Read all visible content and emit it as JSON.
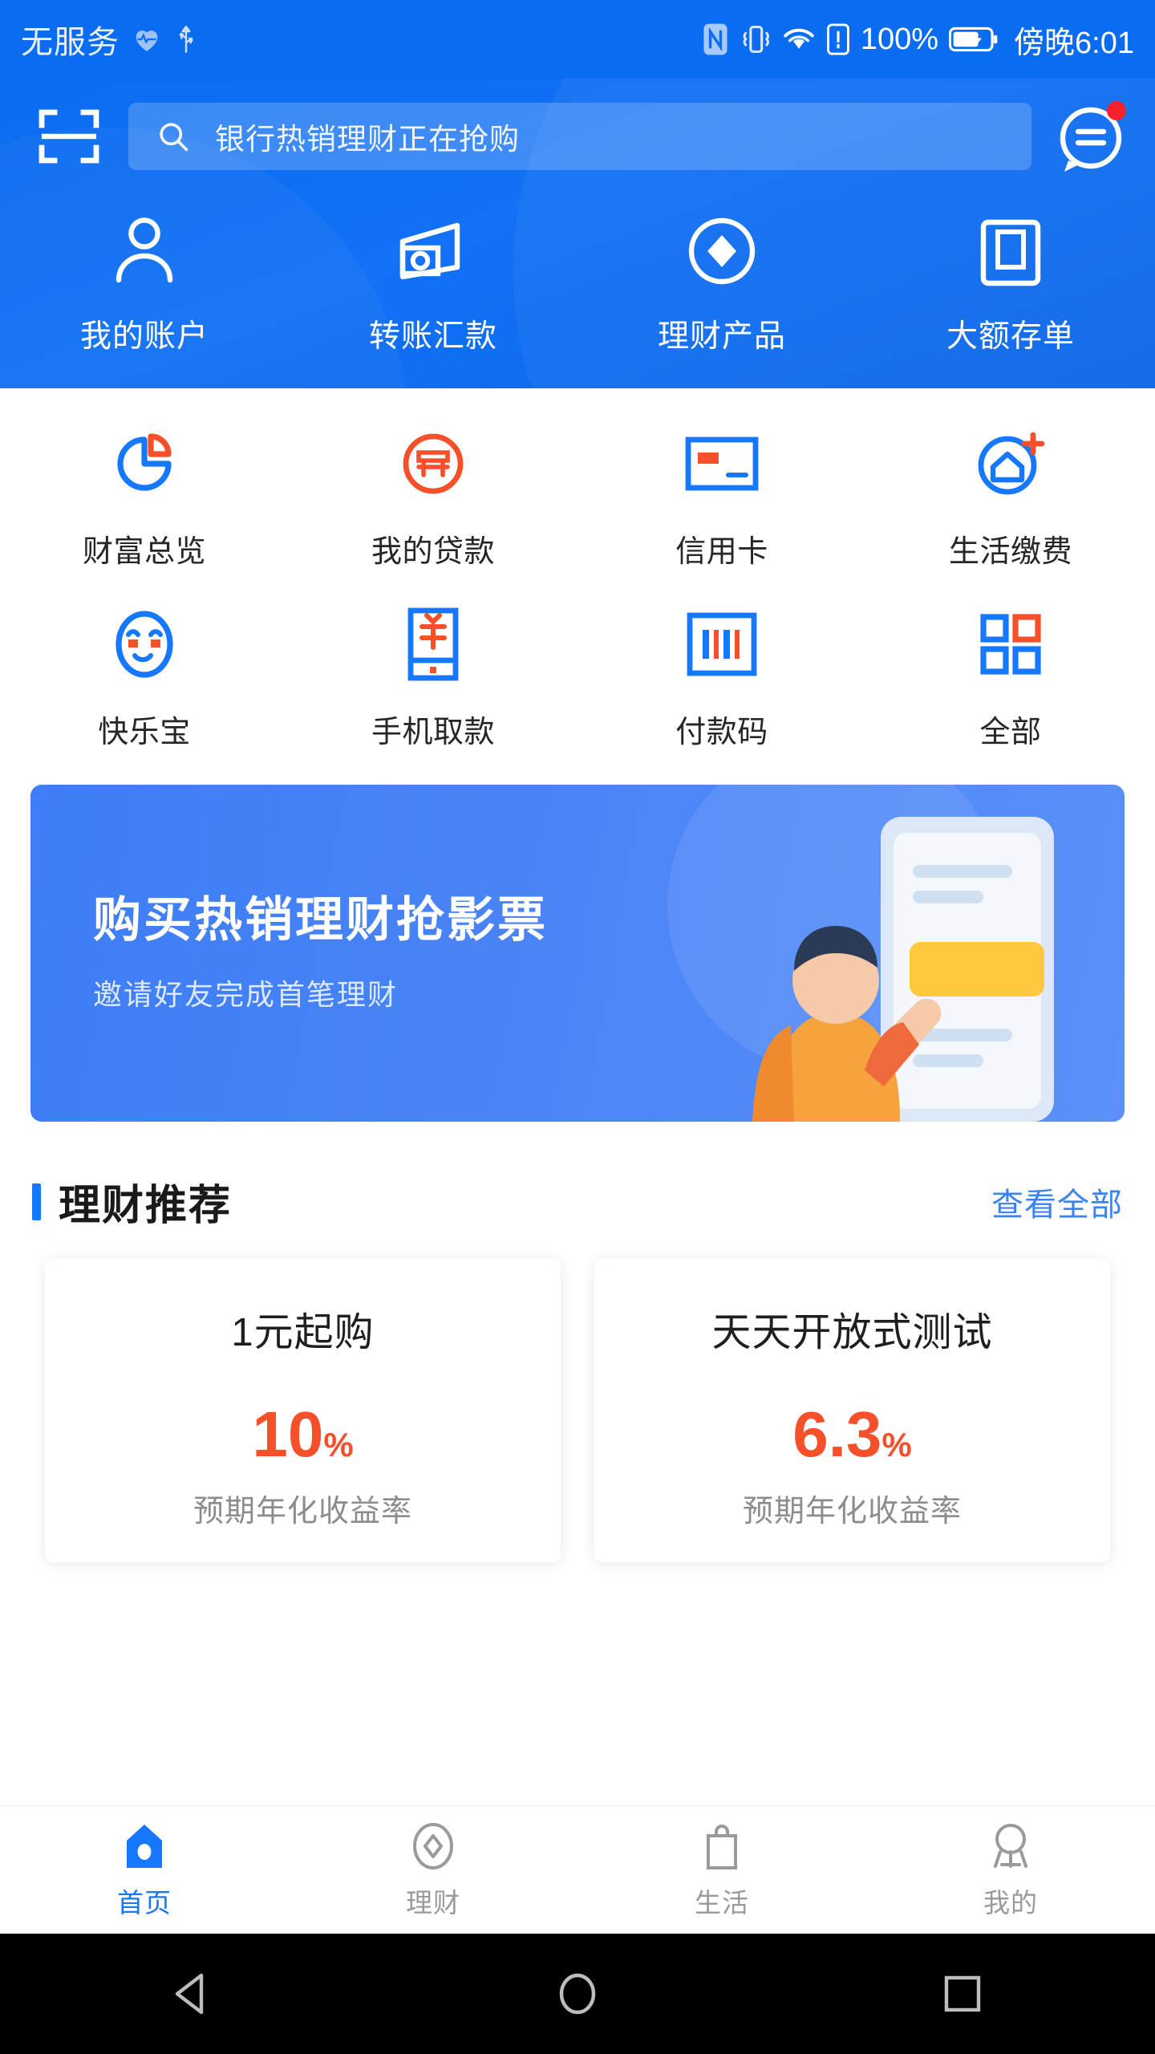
{
  "status_bar": {
    "carrier": "无服务",
    "battery_percent": "100%",
    "time": "傍晚6:01",
    "icons": [
      "heart-icon",
      "usb-icon",
      "nfc-icon",
      "vibrate-icon",
      "wifi-icon",
      "sim-alert-icon",
      "battery-icon"
    ]
  },
  "header": {
    "scan_icon": "scan-icon",
    "search": {
      "icon": "search-icon",
      "value": "银行热销理财正在抢购"
    },
    "message_icon": "message-icon",
    "quick_actions": [
      {
        "label": "我的账户",
        "icon": "person-icon"
      },
      {
        "label": "转账汇款",
        "icon": "transfer-icon"
      },
      {
        "label": "理财产品",
        "icon": "diamond-circle-icon"
      },
      {
        "label": "大额存单",
        "icon": "clipboard-icon"
      }
    ]
  },
  "grid": {
    "rows": [
      [
        {
          "label": "财富总览",
          "icon": "pie-chart-icon"
        },
        {
          "label": "我的贷款",
          "icon": "loan-icon"
        },
        {
          "label": "信用卡",
          "icon": "credit-card-icon"
        },
        {
          "label": "生活缴费",
          "icon": "house-plus-icon"
        }
      ],
      [
        {
          "label": "快乐宝",
          "icon": "smiley-icon"
        },
        {
          "label": "手机取款",
          "icon": "phone-cash-icon"
        },
        {
          "label": "付款码",
          "icon": "barcode-icon"
        },
        {
          "label": "全部",
          "icon": "grid-all-icon"
        }
      ]
    ]
  },
  "banner": {
    "title": "购买热销理财抢影票",
    "subtitle": "邀请好友完成首笔理财"
  },
  "section": {
    "title": "理财推荐",
    "more_label": "查看全部"
  },
  "products": [
    {
      "title": "1元起购",
      "rate_value": "10",
      "rate_unit": "%",
      "rate_label": "预期年化收益率"
    },
    {
      "title": "天天开放式测试",
      "rate_value": "6.3",
      "rate_unit": "%",
      "rate_label": "预期年化收益率"
    }
  ],
  "tab_bar": {
    "active_index": 0,
    "items": [
      {
        "label": "首页",
        "icon": "home-icon"
      },
      {
        "label": "理财",
        "icon": "finance-icon"
      },
      {
        "label": "生活",
        "icon": "life-icon"
      },
      {
        "label": "我的",
        "icon": "profile-icon"
      }
    ]
  },
  "android_nav": {
    "back": "back-triangle-icon",
    "home": "home-circle-icon",
    "recents": "recents-square-icon"
  },
  "colors": {
    "brand_blue": "#0a6cf0",
    "accent_blue": "#1677ff",
    "accent_orange": "#f5502a",
    "banner_blue": "#4c86f7"
  }
}
